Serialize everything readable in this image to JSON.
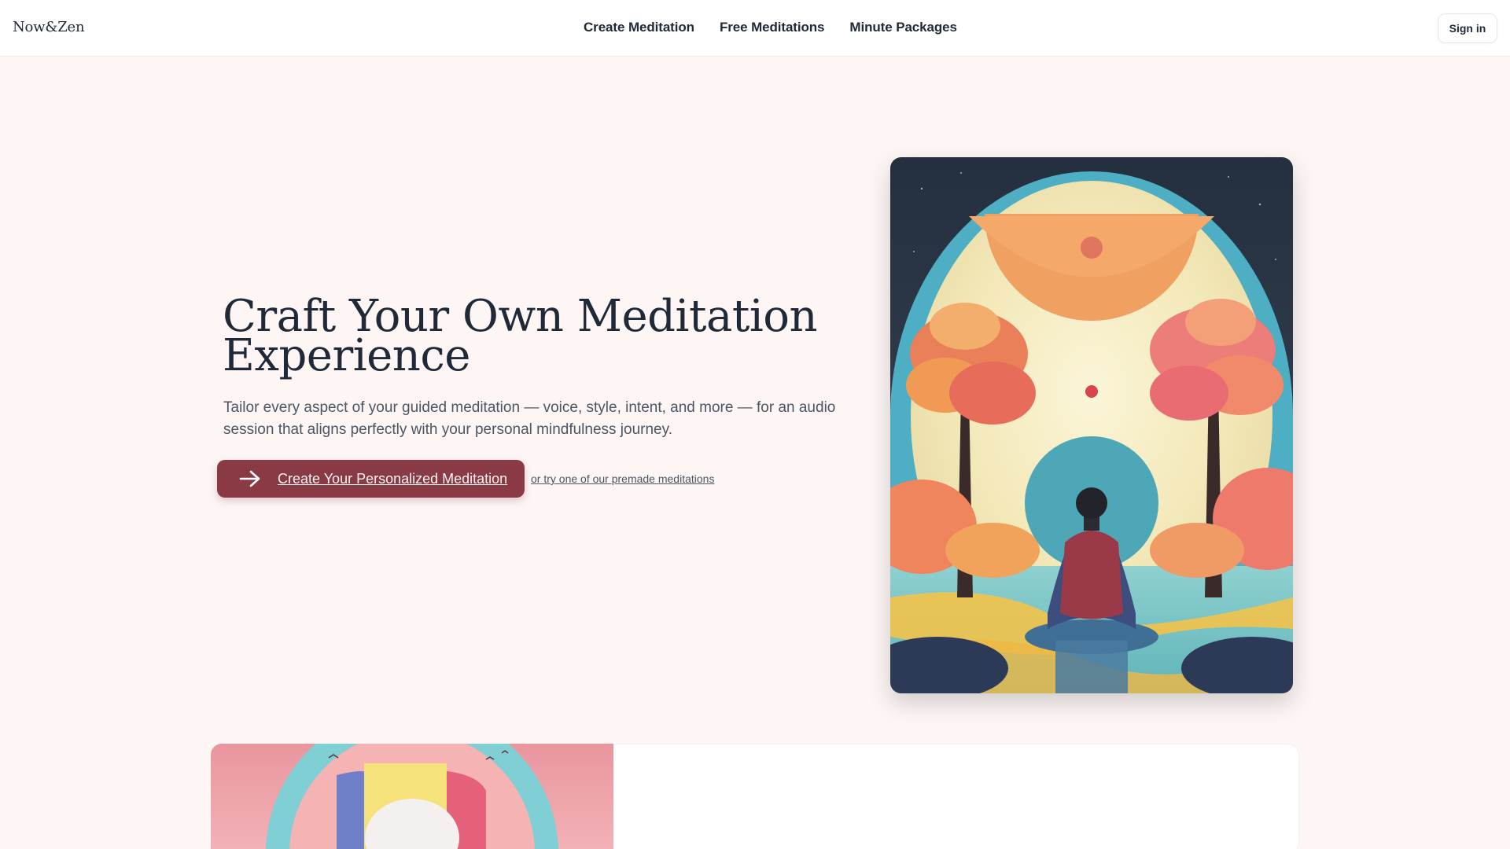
{
  "header": {
    "logo": "Now&Zen",
    "nav": [
      {
        "label": "Create Meditation"
      },
      {
        "label": "Free Meditations"
      },
      {
        "label": "Minute Packages"
      }
    ],
    "signin_label": "Sign in"
  },
  "hero": {
    "title_line1": "Craft Your Own Meditation",
    "title_line2": "Experience",
    "subtitle": "Tailor every aspect of your guided meditation — voice, style, intent, and more — for an audio session that aligns perfectly with your personal mindfulness journey.",
    "cta_label": "Create Your Personalized Meditation",
    "cta_icon": "arrow-right-icon",
    "try_text": "or try one of our premade meditations"
  },
  "colors": {
    "accent": "#8a3a45",
    "page_bg": "#fdf6f5",
    "text": "#1f2937"
  }
}
